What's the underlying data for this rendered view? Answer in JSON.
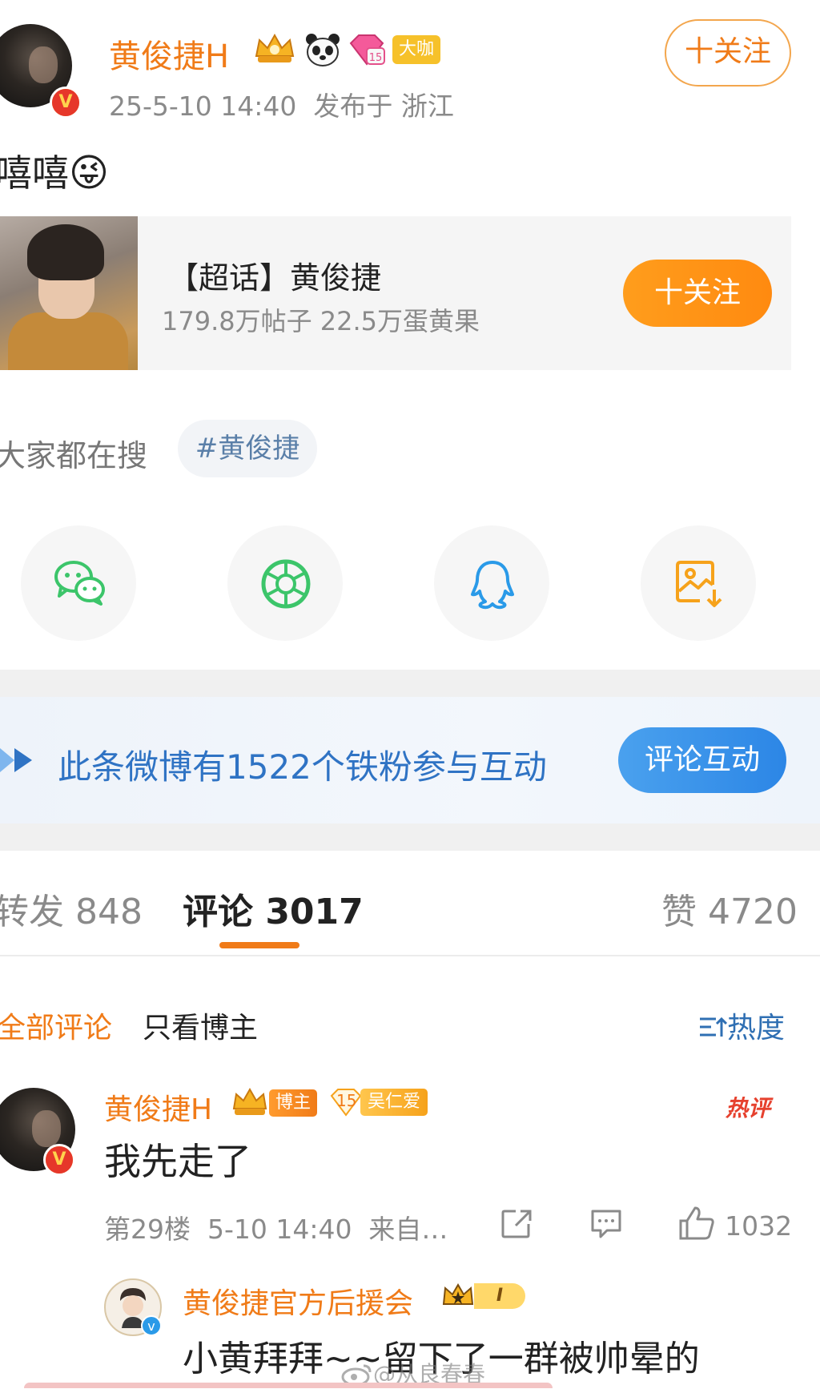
{
  "post": {
    "author": "黄俊捷H",
    "author_badge": "大咖",
    "time_location": "25-5-10 14:40  发布于 浙江",
    "follow_label": "十关注",
    "text": "嘻嘻",
    "emoji": "😜"
  },
  "supertopic": {
    "title": "【超话】黄俊捷",
    "stats": "179.8万帖子 22.5万蛋黄果",
    "follow_label": "十关注"
  },
  "search": {
    "label": "大家都在搜",
    "tag": "#黄俊捷"
  },
  "share": {
    "icons": [
      "wechat-icon",
      "moments-icon",
      "qq-icon",
      "save-image-icon"
    ]
  },
  "fans_banner": {
    "text": "此条微博有1522个铁粉参与互动",
    "button": "评论互动"
  },
  "tabs": {
    "repost": "转发 848",
    "comments": "评论 3017",
    "likes": "赞 4720"
  },
  "filters": {
    "all": "全部评论",
    "blogger_only": "只看博主",
    "sort": "热度"
  },
  "comment": {
    "author": "黄俊捷H",
    "pill_blogger": "博主",
    "pill_fan_level": "15",
    "pill_fan_name": "吴仁爱",
    "hot_label": "热评",
    "text": "我先走了",
    "meta": "第29楼  5-10 14:40  来自…",
    "like_count": "1032"
  },
  "reply": {
    "author": "黄俊捷官方后援会",
    "level_badge": "I",
    "text": "小黄拜拜~~留下了一群被帅晕的"
  },
  "watermark": "@从良春春",
  "colors": {
    "accent_orange": "#f07b18",
    "link_blue": "#2f73c4",
    "wechat_green": "#3cc56a",
    "qq_blue": "#2a9ae8",
    "save_orange": "#f6a21b"
  }
}
